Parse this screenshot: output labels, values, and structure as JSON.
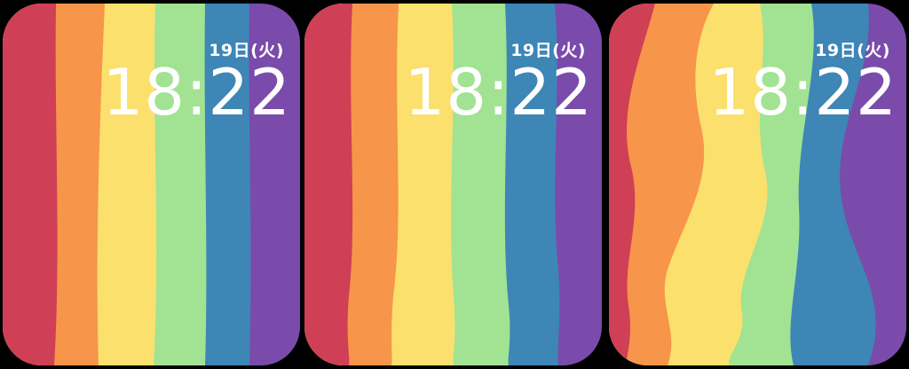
{
  "colors": {
    "background": "#000000",
    "stripes": [
      "#cf3f55",
      "#f7954a",
      "#fbe06e",
      "#a1e392",
      "#3d86b6",
      "#7a4bab"
    ],
    "text": "#ffffff"
  },
  "faces": [
    {
      "date": "19日(火)",
      "time": "18:22"
    },
    {
      "date": "19日(火)",
      "time": "18:22"
    },
    {
      "date": "19日(火)",
      "time": "18:22"
    }
  ]
}
